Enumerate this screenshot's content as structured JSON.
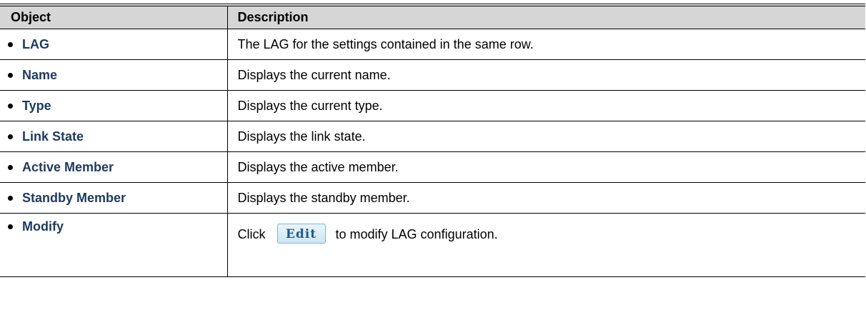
{
  "table": {
    "headers": {
      "object": "Object",
      "description": "Description"
    },
    "rows": [
      {
        "object": "LAG",
        "description": "The LAG for the settings contained in the same row."
      },
      {
        "object": "Name",
        "description": "Displays the current name."
      },
      {
        "object": "Type",
        "description": "Displays the current type."
      },
      {
        "object": "Link State",
        "description": "Displays the link state."
      },
      {
        "object": "Active Member",
        "description": "Displays the active member."
      },
      {
        "object": "Standby Member",
        "description": "Displays the standby member."
      }
    ],
    "modify_row": {
      "object": "Modify",
      "before_button": "Click",
      "button_label": "Edit",
      "after_button": "to modify LAG configuration."
    }
  },
  "colors": {
    "header_bg": "#d6d6d6",
    "object_text": "#1e3a5f",
    "edit_button_text": "#1f5a8a",
    "edit_button_border": "#7fb6d8"
  }
}
